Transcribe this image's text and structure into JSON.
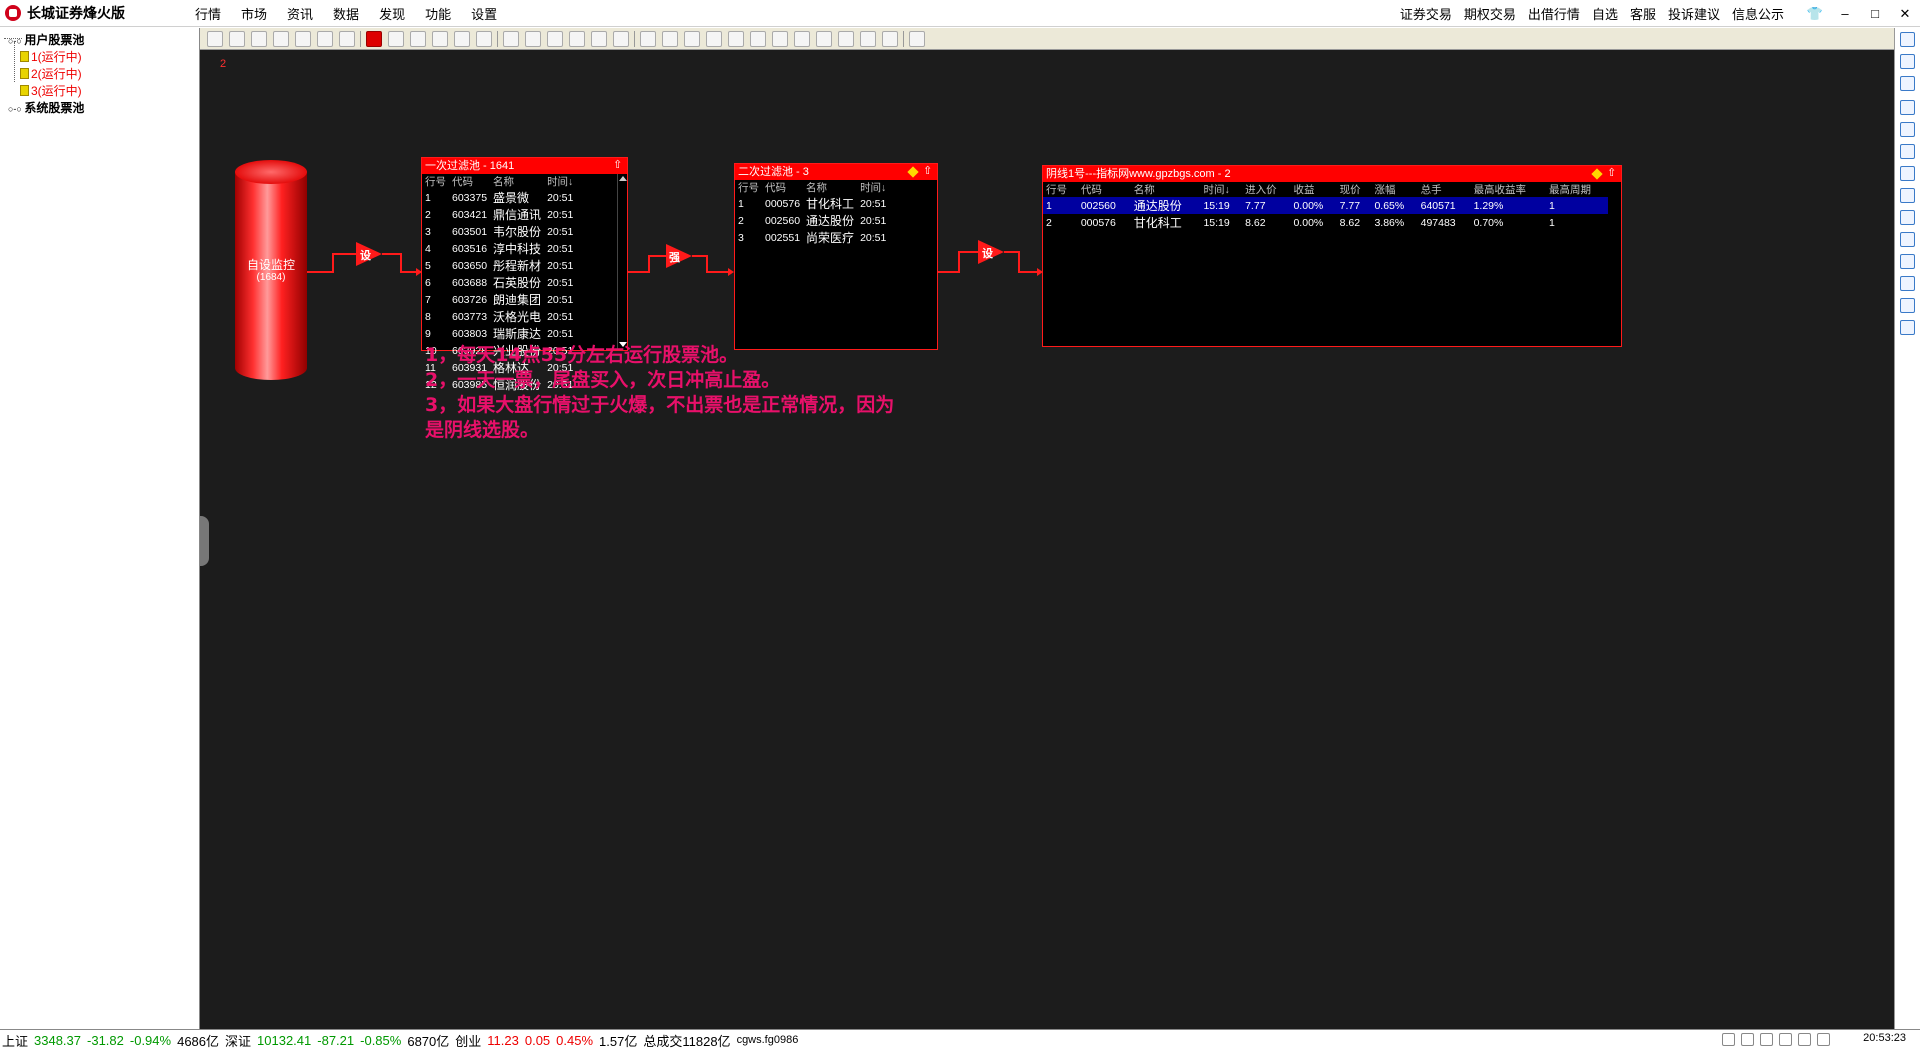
{
  "app": {
    "title": "长城证券烽火版"
  },
  "menu": {
    "items": [
      "行情",
      "市场",
      "资讯",
      "数据",
      "发现",
      "功能",
      "设置"
    ]
  },
  "right_menu": {
    "items": [
      "证券交易",
      "期权交易",
      "出借行情",
      "自选",
      "客服",
      "投诉建议",
      "信息公示"
    ]
  },
  "window_controls": {
    "shirt": "👕",
    "minimize": "–",
    "maximize": "□",
    "close": "✕"
  },
  "sidebar": {
    "user_pool": "用户股票池",
    "children": [
      "1(运行中)",
      "2(运行中)",
      "3(运行中)"
    ],
    "system_pool": "系统股票池"
  },
  "canvas": {
    "page_num": "2"
  },
  "monitor": {
    "label": "自设监控",
    "count": "(1684)"
  },
  "connectors": {
    "c1": "设",
    "c2": "强",
    "c3": "设"
  },
  "panel1": {
    "title": "一次过滤池 - 1641",
    "headers": [
      "行号",
      "代码",
      "名称",
      "时间↓"
    ],
    "rows": [
      [
        "1",
        "603375",
        "盛景微",
        "20:51"
      ],
      [
        "2",
        "603421",
        "鼎信通讯",
        "20:51"
      ],
      [
        "3",
        "603501",
        "韦尔股份",
        "20:51"
      ],
      [
        "4",
        "603516",
        "淳中科技",
        "20:51"
      ],
      [
        "5",
        "603650",
        "彤程新材",
        "20:51"
      ],
      [
        "6",
        "603688",
        "石英股份",
        "20:51"
      ],
      [
        "7",
        "603726",
        "朗迪集团",
        "20:51"
      ],
      [
        "8",
        "603773",
        "沃格光电",
        "20:51"
      ],
      [
        "9",
        "603803",
        "瑞斯康达",
        "20:51"
      ],
      [
        "10",
        "603928",
        "兴业股份",
        "20:51"
      ],
      [
        "11",
        "603931",
        "格林达",
        "20:51"
      ],
      [
        "12",
        "603985",
        "恒润股份",
        "20:51"
      ]
    ]
  },
  "panel2": {
    "title": "二次过滤池 - 3",
    "headers": [
      "行号",
      "代码",
      "名称",
      "时间↓"
    ],
    "rows": [
      [
        "1",
        "000576",
        "甘化科工",
        "20:51"
      ],
      [
        "2",
        "002560",
        "通达股份",
        "20:51"
      ],
      [
        "3",
        "002551",
        "尚荣医疗",
        "20:51"
      ]
    ]
  },
  "panel3": {
    "title": "阴线1号---指标网www.gpzbgs.com - 2",
    "headers": [
      "行号",
      "代码",
      "名称",
      "时间↓",
      "进入价",
      "收益",
      "现价",
      "涨幅",
      "总手",
      "最高收益率",
      "最高周期"
    ],
    "rows": [
      [
        "1",
        "002560",
        "通达股份",
        "15:19",
        "7.77",
        "0.00%",
        "7.77",
        "0.65%",
        "640571",
        "1.29%",
        "1"
      ],
      [
        "2",
        "000576",
        "甘化科工",
        "15:19",
        "8.62",
        "0.00%",
        "8.62",
        "3.86%",
        "497483",
        "0.70%",
        "1"
      ]
    ]
  },
  "notes": [
    "1，每天14点55分左右运行股票池。",
    "2，一天一票，尾盘买入，次日冲高止盈。",
    "3，如果大盘行情过于火爆，不出票也是正常情况，因为",
    "是阴线选股。"
  ],
  "status": {
    "sh_label": "上证",
    "sh_value": "3348.37",
    "sh_change": "-31.82",
    "sh_pct": "-0.94%",
    "sh_amount": "4686亿",
    "sz_label": "深证",
    "sz_value": "10132.41",
    "sz_change": "-87.21",
    "sz_pct": "-0.85%",
    "sz_amount": "6870亿",
    "cy_label": "创业",
    "cy_value": "11.23",
    "cy_change": "0.05",
    "cy_pct": "0.45%",
    "cy_amount": "1.57亿",
    "total_label": "总成交",
    "total_value": "11828亿",
    "user": "cgws.fg0986",
    "clock": "20:53:23"
  }
}
